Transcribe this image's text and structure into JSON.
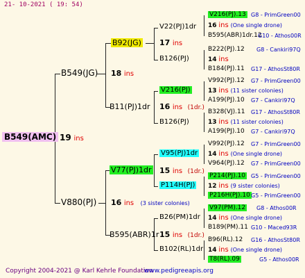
{
  "header": {
    "date": "21-  10-2021  ( 19:  54)"
  },
  "footer": {
    "copyright": "Copyright 2004-2021 @ Karl Kehrle Foundation",
    "site": "www.pedigreeapis.org"
  },
  "root": {
    "name": "B549(AMC)",
    "ins_num": "19",
    "ins_label": "ins"
  },
  "gen1": {
    "top": {
      "name": "B549(JG)",
      "ins_num": "18",
      "ins_label": "ins"
    },
    "bottom": {
      "name": "V880(PJ)",
      "ins_num": "16",
      "ins_label": "ins",
      "note": "(3 sister colonies)"
    }
  },
  "gen2": {
    "a": {
      "name": "B92(JG)",
      "ins_num": "17",
      "ins_label": "ins"
    },
    "b": {
      "name": "B11(PJ)1dr",
      "ins_num": "16",
      "ins_label": "ins",
      "note": "(1dr.)"
    },
    "c": {
      "name": "V77(PJ)1dr",
      "ins_num": "15",
      "ins_label": "ins",
      "note": "(1dr.)"
    },
    "d": {
      "name": "B595(ABR)1r",
      "ins_num": "15",
      "ins_label": "ins",
      "note": "(1dr.)"
    }
  },
  "gen3": {
    "a1": {
      "name": "V22(PJ)1dr"
    },
    "a2": {
      "name": "B126(PJ)"
    },
    "b1": {
      "name": "V216(PJ)",
      "ins_num": "16",
      "ins_label": "ins",
      "note": "(1dr.)"
    },
    "b2": {
      "name": "B126(PJ)"
    },
    "c1": {
      "name": "V95(PJ)1dr",
      "ins_num": "14",
      "ins_label": "ins",
      "note": "(One single drone)"
    },
    "c2": {
      "name": "P114H(PJ)",
      "ins_num": "12",
      "ins_label": "ins",
      "note": "(9 sister colonies)"
    },
    "d1": {
      "name": "B26(PM)1dr"
    },
    "d2": {
      "name": "B102(RL)1dr"
    }
  },
  "gen4": [
    {
      "line": "V216(PJ).13",
      "tag": "G8 - PrimGreen00",
      "style": "green"
    },
    {
      "ins_num": "16",
      "ins_label": "ins",
      "note": "(One single drone)"
    },
    {
      "line": "B595(ABR)1dr.12",
      "tag": "G10 - Athos00R"
    },
    {
      "line": "B222(PJ).12",
      "tag": "G8 - Cankiri97Q"
    },
    {
      "ins_num": "14",
      "ins_label": "ins"
    },
    {
      "line": "B184(PJ).11",
      "tag": "G17 - AthosSt80R"
    },
    {
      "line": "V992(PJ).12",
      "tag": "G7 - PrimGreen00"
    },
    {
      "ins_num": "13",
      "ins_label": "ins",
      "note": "(11 sister colonies)"
    },
    {
      "line": "A199(PJ).10",
      "tag": "G7 - Cankiri97Q"
    },
    {
      "line": "B328(VJ).11",
      "tag": "G17 - AthosSt80R"
    },
    {
      "ins_num": "13",
      "ins_label": "ins",
      "note": "(11 sister colonies)"
    },
    {
      "line": "A199(PJ).10",
      "tag": "G7 - Cankiri97Q"
    },
    {
      "line": "V992(PJ).12",
      "tag": "G7 - PrimGreen00"
    },
    {
      "line": "V964(PJ).12",
      "tag": "G7 - PrimGreen00"
    },
    {
      "line": "P214(PJ).10",
      "tag": "G5 - PrimGreen00",
      "style": "green"
    },
    {
      "line": "P216H(PJ).10",
      "tag": "G5 - PrimGreen00",
      "style": "green"
    },
    {
      "line": "V97(PM).12",
      "tag": "G8 - Athos00R",
      "style": "green"
    },
    {
      "ins_num": "14",
      "ins_label": "ins",
      "note": "(One single drone)"
    },
    {
      "line": "B189(PM).11",
      "tag": "G10 - Maced93R"
    },
    {
      "line": "B96(RL).12",
      "tag": "G16 - AthosSt80R"
    },
    {
      "ins_num": "14",
      "ins_label": "ins",
      "note": "(One single drone)"
    },
    {
      "line": "T8(RL).09",
      "tag": "G5 - Athos00R",
      "style": "green"
    }
  ]
}
